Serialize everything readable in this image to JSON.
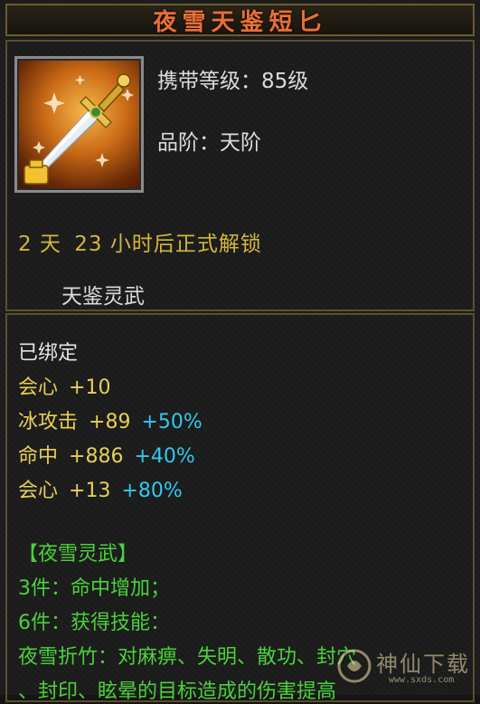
{
  "title": "夜雪天鉴短匕",
  "item": {
    "icon": "dagger-icon",
    "level_label": "携带等级：85级",
    "grade_label": "品阶：天阶"
  },
  "unlock": {
    "days": "2",
    "days_unit": "天",
    "hours": "23",
    "hours_suffix": "小时后正式解锁"
  },
  "weapon_type": "天鉴灵武",
  "status": "已绑定",
  "stats": [
    {
      "name": "会心",
      "value": "+10",
      "bonus": ""
    },
    {
      "name": "冰攻击",
      "value": "+89",
      "bonus": "+50%"
    },
    {
      "name": "命中",
      "value": "+886",
      "bonus": "+40%"
    },
    {
      "name": "会心",
      "value": "+13",
      "bonus": "+80%"
    }
  ],
  "set": {
    "name": "【夜雪灵武】",
    "lines": [
      "3件：命中增加；",
      "6件：获得技能：",
      "夜雪折竹：对麻痹、失明、散功、封穴",
      "、封印、眩晕的目标造成的伤害提高"
    ]
  },
  "watermark": {
    "text": "神仙下载",
    "url": "www.sxds.com"
  },
  "colors": {
    "title": "#e8703a",
    "unlock": "#d4b63c",
    "stat_value": "#e8cf58",
    "stat_bonus": "#32c8f0",
    "set_text": "#4ad23a",
    "border": "#5e4e2c"
  }
}
